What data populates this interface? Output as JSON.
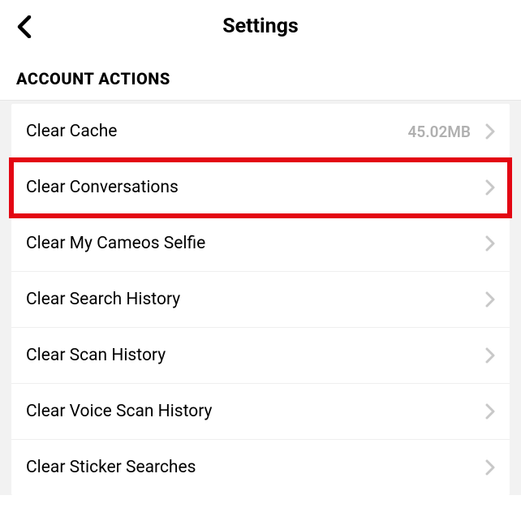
{
  "header": {
    "title": "Settings"
  },
  "section": {
    "title": "ACCOUNT ACTIONS"
  },
  "items": [
    {
      "label": "Clear Cache",
      "value": "45.02MB",
      "highlighted": false
    },
    {
      "label": "Clear Conversations",
      "value": null,
      "highlighted": true
    },
    {
      "label": "Clear My Cameos Selfie",
      "value": null,
      "highlighted": false
    },
    {
      "label": "Clear Search History",
      "value": null,
      "highlighted": false
    },
    {
      "label": "Clear Scan History",
      "value": null,
      "highlighted": false
    },
    {
      "label": "Clear Voice Scan History",
      "value": null,
      "highlighted": false
    },
    {
      "label": "Clear Sticker Searches",
      "value": null,
      "highlighted": false
    }
  ]
}
